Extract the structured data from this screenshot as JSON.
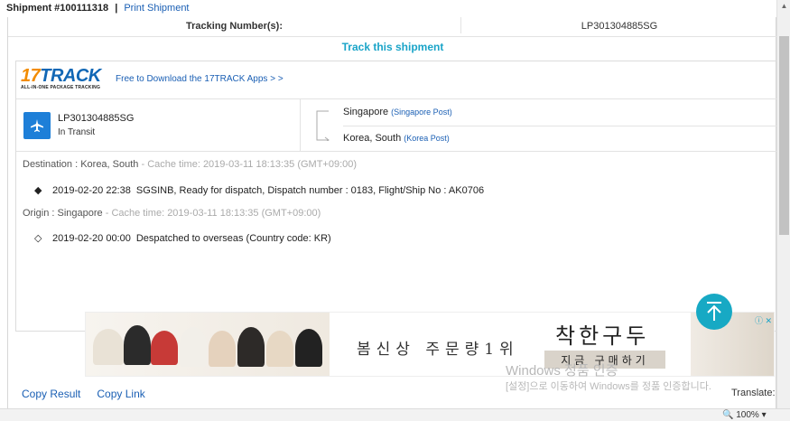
{
  "topbar": {
    "shipment": "Shipment #100111318",
    "separator": "|",
    "print_link": "Print Shipment"
  },
  "tracking": {
    "label": "Tracking Number(s):",
    "value": "LP301304885SG",
    "track_link": "Track this shipment"
  },
  "widget": {
    "logo_main": "17TRACK",
    "logo_17": "17",
    "logo_track": "TRACK",
    "logo_sub": "ALL-IN-ONE PACKAGE TRACKING",
    "download_link": "Free to Download the 17TRACK Apps > >",
    "summary": {
      "number": "LP301304885SG",
      "status": "In Transit",
      "origin_country": "Singapore",
      "origin_carrier": "(Singapore Post)",
      "dest_country": "Korea, South",
      "dest_carrier": "(Korea Post)"
    },
    "destination_group": {
      "label": "Destination : Korea, South",
      "cache": " - Cache time: 2019-03-11 18:13:35 (GMT+09:00)",
      "events": [
        {
          "mark": "◆",
          "time": "2019-02-20 22:38",
          "text": "SGSINB, Ready for dispatch, Dispatch number : 0183, Flight/Ship No : AK0706"
        }
      ]
    },
    "origin_group": {
      "label": "Origin : Singapore",
      "cache": " - Cache time: 2019-03-11 18:13:35 (GMT+09:00)",
      "events": [
        {
          "mark": "◇",
          "time": "2019-02-20 00:00",
          "text": "Despatched to overseas (Country code: KR)"
        }
      ]
    }
  },
  "ad": {
    "headline": "봄신상 주문량1위",
    "brand": "착한구두",
    "buy": "지금 구매하기",
    "choices": "ⓘ ✕"
  },
  "watermark": {
    "line1": "Windows 정품 인증",
    "line2": "[설정]으로 이동하여 Windows를 정품 인증합니다."
  },
  "bottom": {
    "copy_result": "Copy Result",
    "copy_link": "Copy Link",
    "translate": "Translate:"
  },
  "status": {
    "zoom": "🔍 100%  ▾"
  },
  "colors": {
    "link": "#1a5fb4",
    "accent": "#1aa4c8",
    "plane_box": "#1e7fd8",
    "logo_orange": "#f28c00"
  }
}
